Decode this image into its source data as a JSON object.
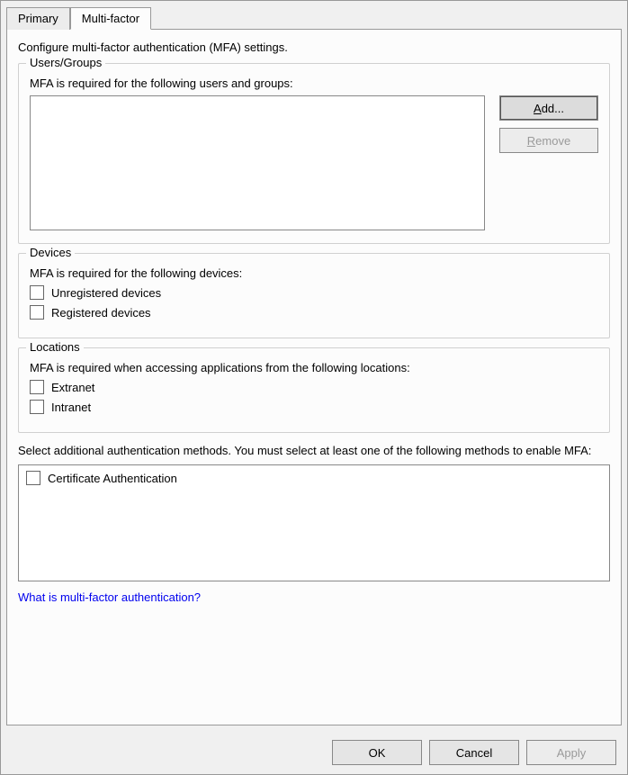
{
  "tabs": {
    "primary": "Primary",
    "multifactor": "Multi-factor"
  },
  "panel": {
    "description": "Configure multi-factor authentication (MFA) settings."
  },
  "usersGroups": {
    "title": "Users/Groups",
    "subtitle": "MFA is required for the following users and groups:",
    "add": "dd...",
    "addAccel": "A",
    "remove": "emove",
    "removeAccel": "R"
  },
  "devices": {
    "title": "Devices",
    "subtitle": "MFA is required for the following devices:",
    "unregistered": "Unregistered devices",
    "registered": "Registered devices"
  },
  "locations": {
    "title": "Locations",
    "subtitle": "MFA is required when accessing applications from the following locations:",
    "extranet": "Extranet",
    "intranet": "Intranet"
  },
  "methods": {
    "description": "Select additional authentication methods. You must select at least one of the following methods to enable MFA:",
    "certificate": "Certificate Authentication"
  },
  "link": "What is multi-factor authentication?",
  "buttons": {
    "ok": "OK",
    "cancel": "Cancel",
    "apply": "Apply"
  }
}
